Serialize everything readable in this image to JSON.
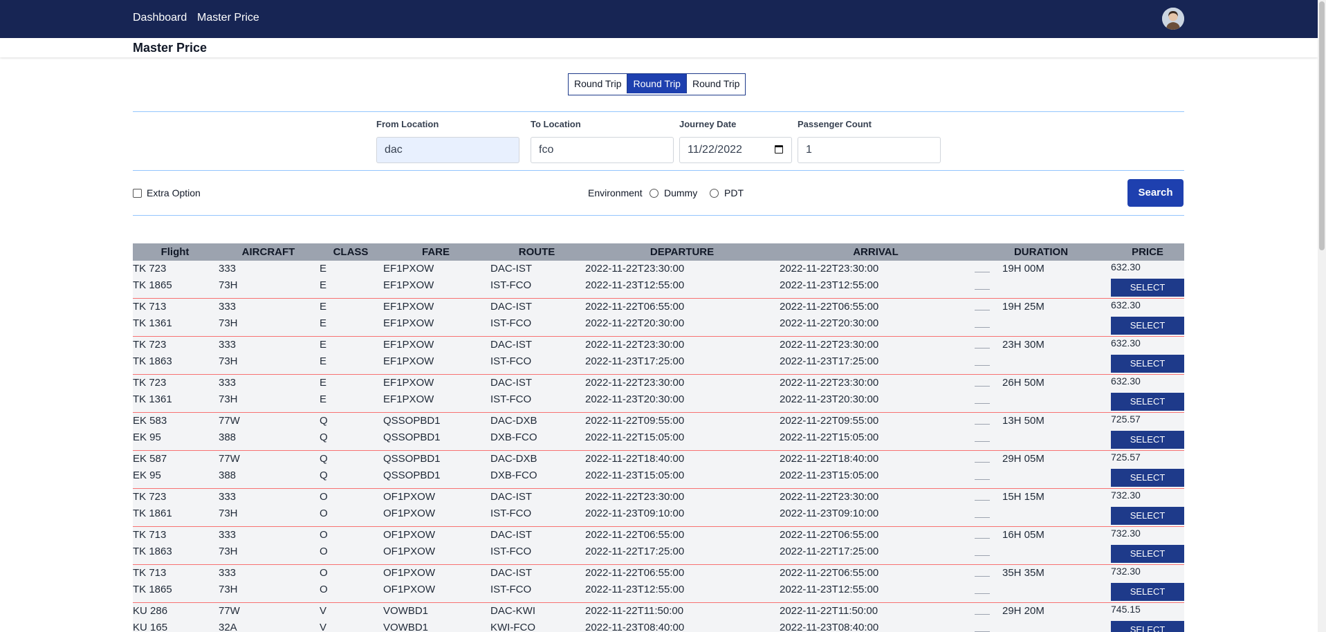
{
  "nav": {
    "links": [
      "Dashboard",
      "Master Price"
    ]
  },
  "page": {
    "title": "Master Price"
  },
  "trip_types": [
    {
      "label": "Round Trip",
      "active": false
    },
    {
      "label": "Round Trip",
      "active": true
    },
    {
      "label": "Round Trip",
      "active": false
    }
  ],
  "form": {
    "from": {
      "label": "From Location",
      "value": "dac"
    },
    "to": {
      "label": "To Location",
      "value": "fco"
    },
    "date": {
      "label": "Journey Date",
      "value": "11/22/2022"
    },
    "passengers": {
      "label": "Passenger Count",
      "value": "1"
    },
    "extra_option": "Extra Option",
    "environment": {
      "label": "Environment",
      "options": [
        "Dummy",
        "PDT"
      ]
    },
    "search_label": "Search"
  },
  "table": {
    "headers": [
      "Flight",
      "AIRCRAFT",
      "CLASS",
      "FARE",
      "ROUTE",
      "DEPARTURE",
      "ARRIVAL",
      "DURATION",
      "PRICE"
    ],
    "select_label": "SELECT",
    "rows": [
      {
        "legs": [
          [
            "TK 723",
            "333",
            "E",
            "EF1PXOW",
            "DAC-IST",
            "2022-11-22T23:30:00",
            "2022-11-22T23:30:00"
          ],
          [
            "TK 1865",
            "73H",
            "E",
            "EF1PXOW",
            "IST-FCO",
            "2022-11-23T12:55:00",
            "2022-11-23T12:55:00"
          ]
        ],
        "duration": "19H 00M",
        "price": "632.30"
      },
      {
        "legs": [
          [
            "TK 713",
            "333",
            "E",
            "EF1PXOW",
            "DAC-IST",
            "2022-11-22T06:55:00",
            "2022-11-22T06:55:00"
          ],
          [
            "TK 1361",
            "73H",
            "E",
            "EF1PXOW",
            "IST-FCO",
            "2022-11-22T20:30:00",
            "2022-11-22T20:30:00"
          ]
        ],
        "duration": "19H 25M",
        "price": "632.30"
      },
      {
        "legs": [
          [
            "TK 723",
            "333",
            "E",
            "EF1PXOW",
            "DAC-IST",
            "2022-11-22T23:30:00",
            "2022-11-22T23:30:00"
          ],
          [
            "TK 1863",
            "73H",
            "E",
            "EF1PXOW",
            "IST-FCO",
            "2022-11-23T17:25:00",
            "2022-11-23T17:25:00"
          ]
        ],
        "duration": "23H 30M",
        "price": "632.30"
      },
      {
        "legs": [
          [
            "TK 723",
            "333",
            "E",
            "EF1PXOW",
            "DAC-IST",
            "2022-11-22T23:30:00",
            "2022-11-22T23:30:00"
          ],
          [
            "TK 1361",
            "73H",
            "E",
            "EF1PXOW",
            "IST-FCO",
            "2022-11-23T20:30:00",
            "2022-11-23T20:30:00"
          ]
        ],
        "duration": "26H 50M",
        "price": "632.30"
      },
      {
        "legs": [
          [
            "EK 583",
            "77W",
            "Q",
            "QSSOPBD1",
            "DAC-DXB",
            "2022-11-22T09:55:00",
            "2022-11-22T09:55:00"
          ],
          [
            "EK 95",
            "388",
            "Q",
            "QSSOPBD1",
            "DXB-FCO",
            "2022-11-22T15:05:00",
            "2022-11-22T15:05:00"
          ]
        ],
        "duration": "13H 50M",
        "price": "725.57"
      },
      {
        "legs": [
          [
            "EK 587",
            "77W",
            "Q",
            "QSSOPBD1",
            "DAC-DXB",
            "2022-11-22T18:40:00",
            "2022-11-22T18:40:00"
          ],
          [
            "EK 95",
            "388",
            "Q",
            "QSSOPBD1",
            "DXB-FCO",
            "2022-11-23T15:05:00",
            "2022-11-23T15:05:00"
          ]
        ],
        "duration": "29H 05M",
        "price": "725.57"
      },
      {
        "legs": [
          [
            "TK 723",
            "333",
            "O",
            "OF1PXOW",
            "DAC-IST",
            "2022-11-22T23:30:00",
            "2022-11-22T23:30:00"
          ],
          [
            "TK 1861",
            "73H",
            "O",
            "OF1PXOW",
            "IST-FCO",
            "2022-11-23T09:10:00",
            "2022-11-23T09:10:00"
          ]
        ],
        "duration": "15H 15M",
        "price": "732.30"
      },
      {
        "legs": [
          [
            "TK 713",
            "333",
            "O",
            "OF1PXOW",
            "DAC-IST",
            "2022-11-22T06:55:00",
            "2022-11-22T06:55:00"
          ],
          [
            "TK 1863",
            "73H",
            "O",
            "OF1PXOW",
            "IST-FCO",
            "2022-11-22T17:25:00",
            "2022-11-22T17:25:00"
          ]
        ],
        "duration": "16H 05M",
        "price": "732.30"
      },
      {
        "legs": [
          [
            "TK 713",
            "333",
            "O",
            "OF1PXOW",
            "DAC-IST",
            "2022-11-22T06:55:00",
            "2022-11-22T06:55:00"
          ],
          [
            "TK 1865",
            "73H",
            "O",
            "OF1PXOW",
            "IST-FCO",
            "2022-11-23T12:55:00",
            "2022-11-23T12:55:00"
          ]
        ],
        "duration": "35H 35M",
        "price": "732.30"
      },
      {
        "legs": [
          [
            "KU 286",
            "77W",
            "V",
            "VOWBD1",
            "DAC-KWI",
            "2022-11-22T11:50:00",
            "2022-11-22T11:50:00"
          ],
          [
            "KU 165",
            "32A",
            "V",
            "VOWBD1",
            "KWI-FCO",
            "2022-11-23T08:40:00",
            "2022-11-23T08:40:00"
          ]
        ],
        "duration": "29H 20M",
        "price": "745.15"
      }
    ]
  }
}
